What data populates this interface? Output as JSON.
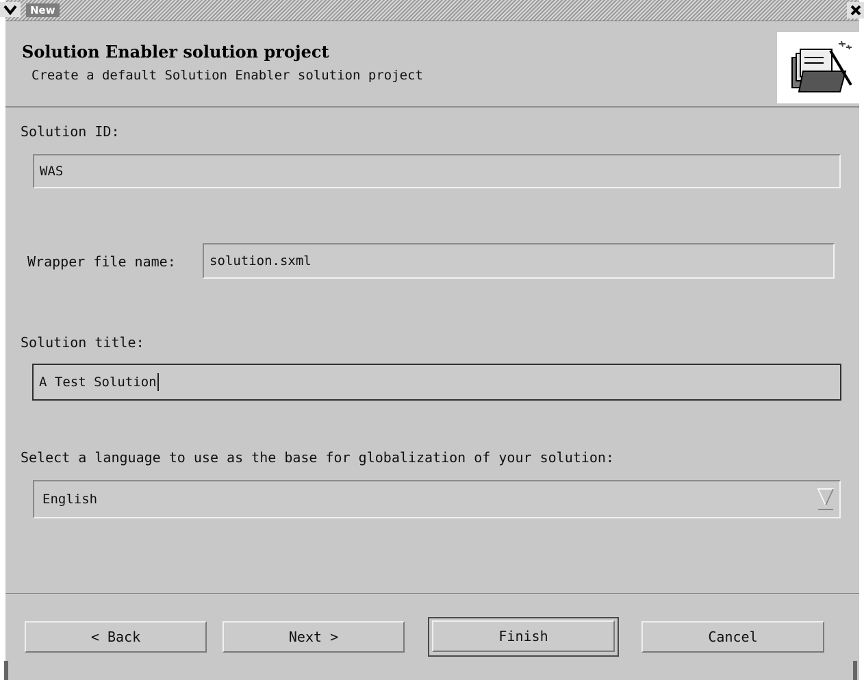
{
  "window": {
    "title": "New"
  },
  "header": {
    "title": "Solution Enabler solution project",
    "description": "Create a default Solution Enabler solution project",
    "image_icon": "wizard-folder-icon"
  },
  "form": {
    "solution_id": {
      "label": "Solution ID:",
      "value": "WAS"
    },
    "wrapper_file": {
      "label": "Wrapper file name:",
      "value": "solution.sxml"
    },
    "solution_title": {
      "label": "Solution title:",
      "value": "A Test Solution"
    },
    "language": {
      "label": "Select a language to use as the base for globalization of your solution:",
      "selected": "English"
    }
  },
  "buttons": {
    "back": "< Back",
    "next": "Next >",
    "finish": "Finish",
    "cancel": "Cancel"
  },
  "colors": {
    "dialog_bg": "#c8c8c8",
    "title_highlight": "#7d7d7d"
  }
}
